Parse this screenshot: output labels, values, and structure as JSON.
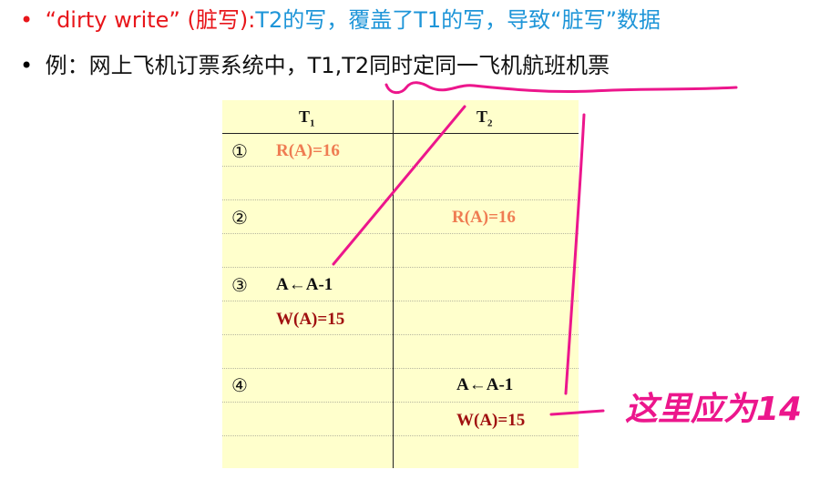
{
  "bullets": {
    "marker": "•",
    "line1": {
      "term": "“dirty write” (脏写):",
      "desc": "T2的写，覆盖了T1的写，导致“脏写”数据"
    },
    "line2": {
      "prefix": "例：网上飞机订票系统中，",
      "subject": "T1,T2",
      "suffix": "同时定同一飞机航班机票"
    }
  },
  "schedule": {
    "header": {
      "t1": "T",
      "t1_sub": "1",
      "t2": "T",
      "t2_sub": "2"
    },
    "steps": [
      "①",
      "②",
      "③",
      "④"
    ],
    "ops": {
      "t1_read": "R(A)=16",
      "t2_read": "R(A)=16",
      "t1_compute": "A←A-1",
      "t1_write": "W(A)=15",
      "t2_compute": "A←A-1",
      "t2_write": "W(A)=15"
    }
  },
  "annotation": {
    "handwritten_note": "这里应为14",
    "color": "#ec168c"
  },
  "colors": {
    "term_red": "#e8161b",
    "desc_blue": "#1e95d8",
    "table_bg": "#ffffcc",
    "read_orange": "#ef7c52",
    "write_darkred": "#a01010"
  }
}
